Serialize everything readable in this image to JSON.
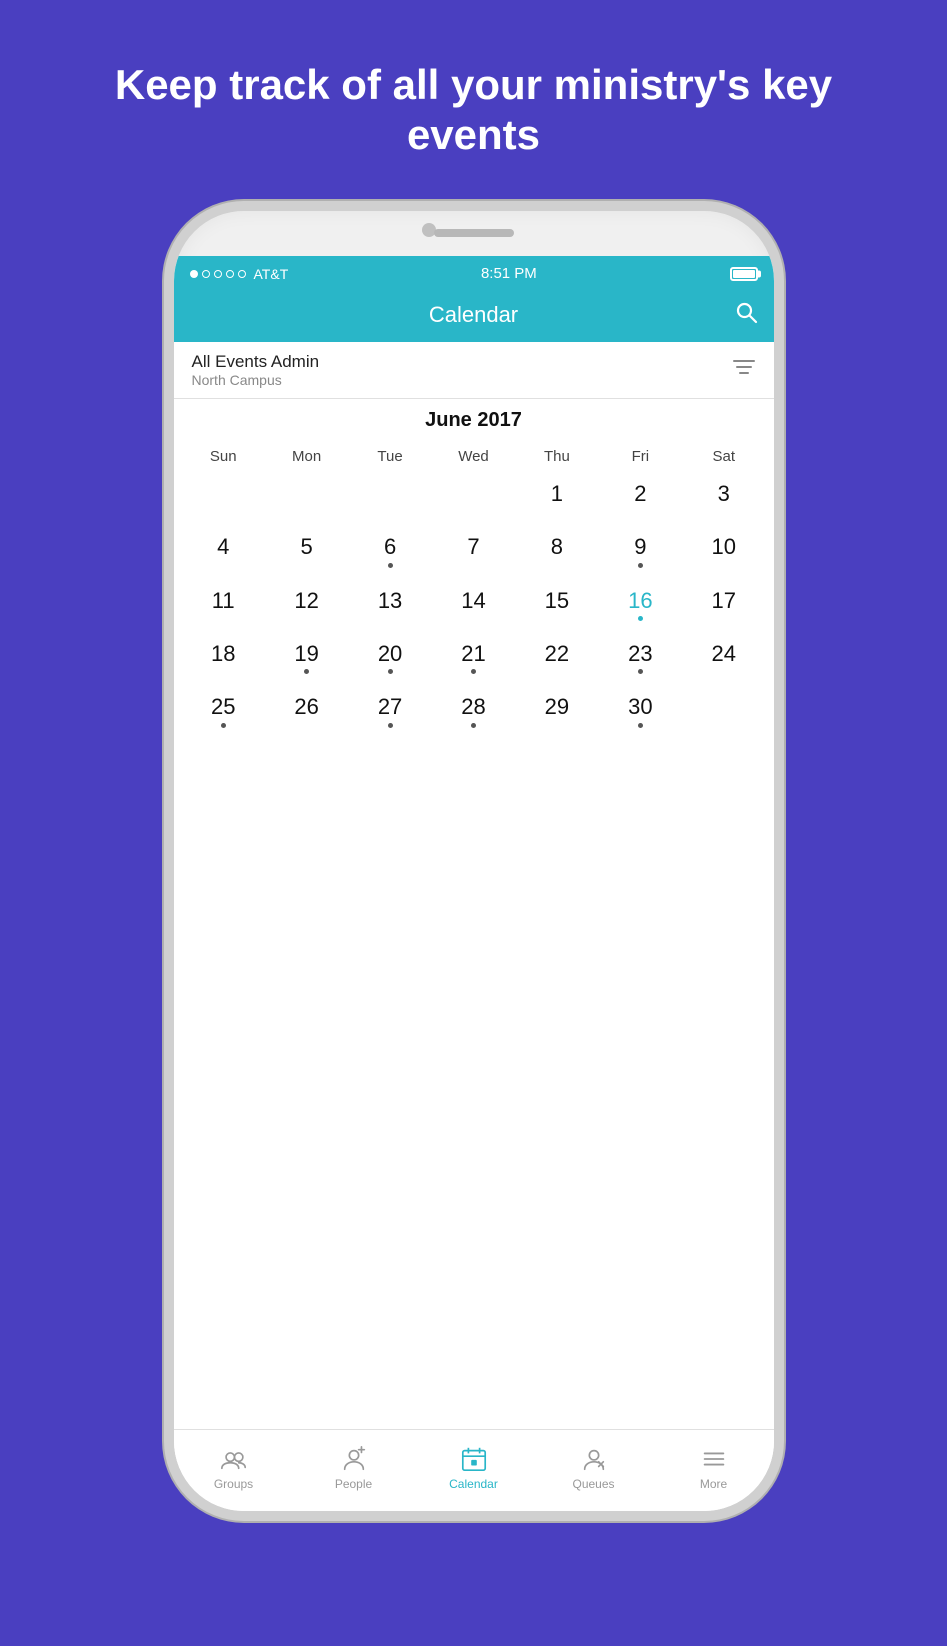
{
  "headline": "Keep track of all your ministry's key events",
  "status_bar": {
    "carrier": "AT&T",
    "time": "8:51 PM"
  },
  "app_header": {
    "title": "Calendar"
  },
  "filter": {
    "title": "All Events Admin",
    "subtitle": "North Campus"
  },
  "calendar": {
    "month_title": "June 2017",
    "days_of_week": [
      "Sun",
      "Mon",
      "Tue",
      "Wed",
      "Thu",
      "Fri",
      "Sat"
    ],
    "weeks": [
      [
        {
          "day": "",
          "dot": false
        },
        {
          "day": "",
          "dot": false
        },
        {
          "day": "",
          "dot": false
        },
        {
          "day": "",
          "dot": false
        },
        {
          "day": "1",
          "dot": false
        },
        {
          "day": "2",
          "dot": false
        },
        {
          "day": "3",
          "dot": false
        }
      ],
      [
        {
          "day": "4",
          "dot": false
        },
        {
          "day": "5",
          "dot": false
        },
        {
          "day": "6",
          "dot": true,
          "dot_type": "dark"
        },
        {
          "day": "7",
          "dot": false
        },
        {
          "day": "8",
          "dot": false
        },
        {
          "day": "9",
          "dot": true,
          "dot_type": "dark"
        },
        {
          "day": "10",
          "dot": false
        }
      ],
      [
        {
          "day": "11",
          "dot": false
        },
        {
          "day": "12",
          "dot": false
        },
        {
          "day": "13",
          "dot": false
        },
        {
          "day": "14",
          "dot": false
        },
        {
          "day": "15",
          "dot": false
        },
        {
          "day": "16",
          "dot": true,
          "dot_type": "cyan",
          "today": true
        },
        {
          "day": "17",
          "dot": false
        }
      ],
      [
        {
          "day": "18",
          "dot": false
        },
        {
          "day": "19",
          "dot": true,
          "dot_type": "dark"
        },
        {
          "day": "20",
          "dot": true,
          "dot_type": "dark"
        },
        {
          "day": "21",
          "dot": true,
          "dot_type": "dark"
        },
        {
          "day": "22",
          "dot": false
        },
        {
          "day": "23",
          "dot": true,
          "dot_type": "dark"
        },
        {
          "day": "24",
          "dot": false
        }
      ],
      [
        {
          "day": "25",
          "dot": true,
          "dot_type": "dark"
        },
        {
          "day": "26",
          "dot": false
        },
        {
          "day": "27",
          "dot": true,
          "dot_type": "dark"
        },
        {
          "day": "28",
          "dot": true,
          "dot_type": "dark"
        },
        {
          "day": "29",
          "dot": false
        },
        {
          "day": "30",
          "dot": true,
          "dot_type": "dark"
        },
        {
          "day": "",
          "dot": false
        }
      ]
    ]
  },
  "tab_bar": {
    "items": [
      {
        "label": "Groups",
        "active": false
      },
      {
        "label": "People",
        "active": false
      },
      {
        "label": "Calendar",
        "active": true
      },
      {
        "label": "Queues",
        "active": false
      },
      {
        "label": "More",
        "active": false
      }
    ]
  }
}
